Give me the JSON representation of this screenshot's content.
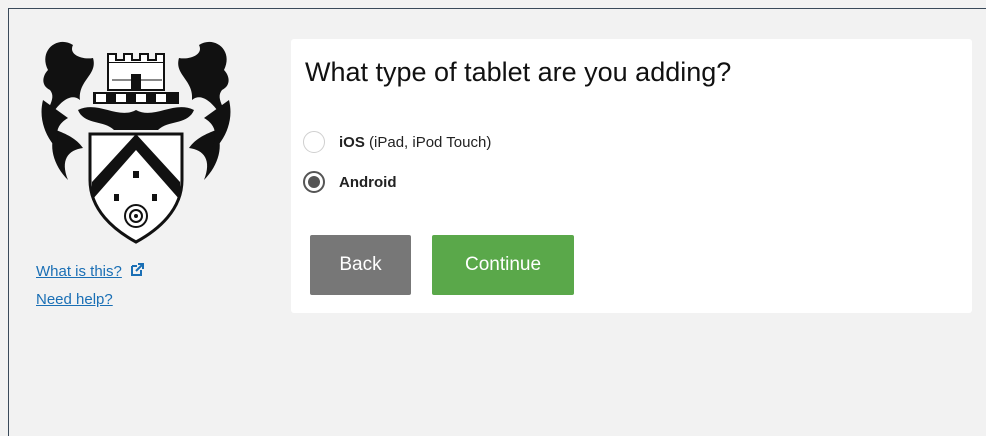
{
  "sidebar": {
    "logo_icon": "university-crest-icon",
    "what_is_this": "What is this?",
    "external_link_icon": "external-link-icon",
    "need_help": "Need help?"
  },
  "form": {
    "question": "What type of tablet are you adding?",
    "options": [
      {
        "label_bold": "iOS",
        "label_rest": "(iPad, iPod Touch)",
        "selected": false
      },
      {
        "label_bold": "Android",
        "label_rest": "",
        "selected": true
      }
    ],
    "back_label": "Back",
    "continue_label": "Continue"
  },
  "colors": {
    "background": "#f2f2f2",
    "panel": "#ffffff",
    "back_button": "#777777",
    "continue_button": "#5aa84a",
    "link": "#1a6fb5"
  }
}
